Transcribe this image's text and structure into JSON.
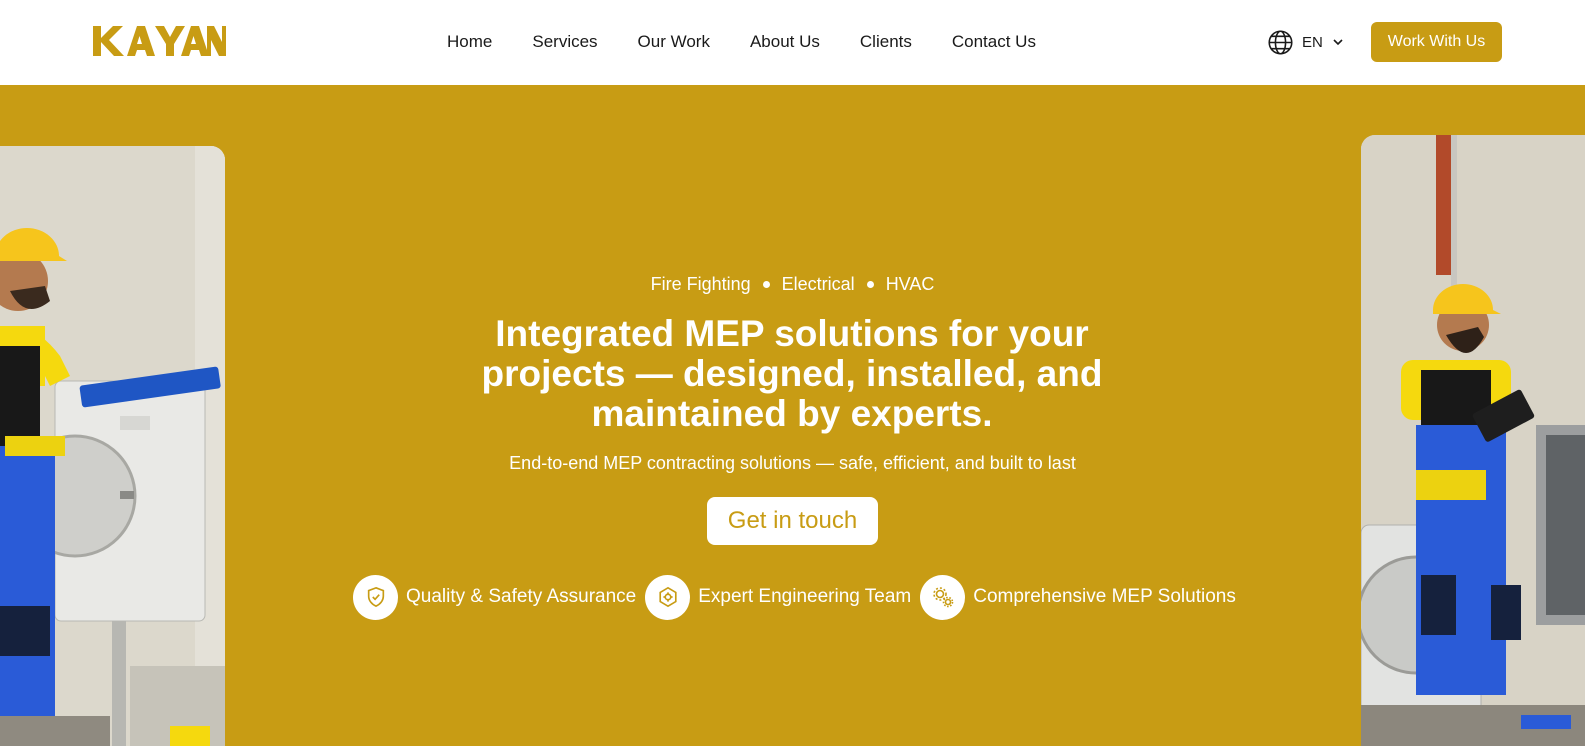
{
  "brand": {
    "logo_text": "KAYAN",
    "accent": "#c89c14"
  },
  "nav": {
    "items": [
      "Home",
      "Services",
      "Our Work",
      "About Us",
      "Clients",
      "Contact Us"
    ]
  },
  "language": {
    "code": "EN",
    "icon": "globe-icon"
  },
  "header_cta": {
    "label": "Work With Us"
  },
  "hero": {
    "tags": [
      "Fire Fighting",
      "Electrical",
      "HVAC"
    ],
    "headline": "Integrated MEP solutions for your projects — designed, installed, and maintained by experts.",
    "subline": "End-to-end MEP contracting solutions — safe, efficient, and built to last",
    "cta_label": "Get in touch",
    "features": [
      {
        "label": "Quality & Safety Assurance",
        "icon": "shield-check-icon"
      },
      {
        "label": "Expert Engineering Team",
        "icon": "engineering-icon"
      },
      {
        "label": "Comprehensive MEP Solutions",
        "icon": "gears-icon"
      }
    ]
  }
}
